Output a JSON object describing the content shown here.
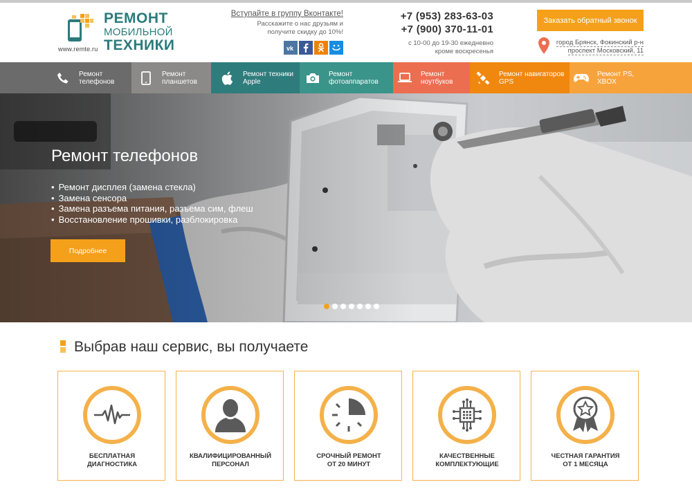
{
  "header": {
    "site": "www.remte.ru",
    "logo_line1": "РЕМОНТ",
    "logo_line2": "МОБИЛЬНОЙ",
    "logo_line3": "ТЕХНИКИ",
    "vk_title": "Вступайте в группу Вконтакте!",
    "vk_line1": "Расскажите о нас друзьям и",
    "vk_line2": "получите скидку до 10%!",
    "socials": [
      "vk",
      "f",
      "ok",
      "mm"
    ],
    "phone1": "+7 (953) 283-63-03",
    "phone2": "+7 (900) 370-11-01",
    "hours_line1": "с 10-00 до 19-30 ежедневно",
    "hours_line2": "кроме воскресенья",
    "callback_label": "Заказать обратный звонок",
    "address_line1": "город Брянск, Фокинский р-н",
    "address_line2": "проспект Московский, 11"
  },
  "nav": {
    "items": [
      {
        "label": "Ремонт\nтелефонов",
        "icon": "phone-icon",
        "color": "#6b6b6b"
      },
      {
        "label": "Ремонт\nпланшетов",
        "icon": "tablet-icon",
        "color": "#8c8a88"
      },
      {
        "label": "Ремонт техники\nApple",
        "icon": "apple-icon",
        "color": "#2f7c7c"
      },
      {
        "label": "Ремонт\nфотоаппаратов",
        "icon": "camera-icon",
        "color": "#3a948a"
      },
      {
        "label": "Ремонт\nноутбуков",
        "icon": "laptop-icon",
        "color": "#ec6e50"
      },
      {
        "label": "Ремонт навигаторов\nGPS",
        "icon": "satellite-icon",
        "color": "#f0870f"
      },
      {
        "label": "Ремонт PS,\nXBOX",
        "icon": "gamepad-icon",
        "color": "#f7a33c"
      }
    ]
  },
  "hero": {
    "title": "Ремонт телефонов",
    "bullets": [
      "Ремонт дисплея (замена стекла)",
      "Замена сенсора",
      "Замена разъема питания, разъема сим, флеш",
      "Восстановление прошивки, разблокировка"
    ],
    "button_label": "Подробнее",
    "slides": 7,
    "active_slide": 1
  },
  "benefits": {
    "title": "Выбрав наш сервис, вы получаете",
    "cards": [
      {
        "label": "БЕСПЛАТНАЯ\nДИАГНОСТИКА",
        "icon": "pulse-icon"
      },
      {
        "label": "КВАЛИФИЦИРОВАННЫЙ\nПЕРСОНАЛ",
        "icon": "person-icon"
      },
      {
        "label": "СРОЧНЫЙ РЕМОНТ\nОТ 20 МИНУТ",
        "icon": "clock-icon"
      },
      {
        "label": "КАЧЕСТВЕННЫЕ\nКОМПЛЕКТУЮЩИЕ",
        "icon": "chip-icon"
      },
      {
        "label": "ЧЕСТНАЯ ГАРАНТИЯ\nОТ 1 МЕСЯЦА",
        "icon": "award-icon"
      }
    ]
  },
  "colors": {
    "accent": "#f5a01a",
    "brand": "#2b7b7b",
    "card_border": "#f4b14a"
  }
}
